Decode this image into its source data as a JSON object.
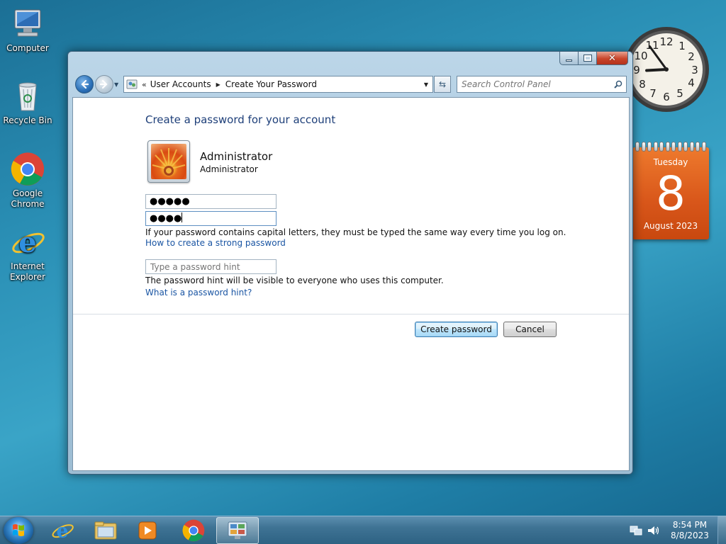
{
  "desktop": {
    "icons": [
      {
        "label": "Computer",
        "icon": "computer-icon"
      },
      {
        "label": "Recycle Bin",
        "icon": "recycle-bin-icon"
      },
      {
        "label": "Google Chrome",
        "icon": "chrome-icon"
      },
      {
        "label": "Internet Explorer",
        "icon": "internet-explorer-icon"
      }
    ]
  },
  "window": {
    "breadcrumb": [
      "User Accounts",
      "Create Your Password"
    ],
    "history_chevron": "«",
    "search_placeholder": "Search Control Panel",
    "heading": "Create a password for your account",
    "user_name": "Administrator",
    "user_role": "Administrator",
    "password_mask": "●●●●●",
    "confirm_mask": "●●●●",
    "caps_note": "If your password contains capital letters, they must be typed the same way every time you log on.",
    "strong_link": "How to create a strong password",
    "hint_placeholder": "Type a password hint",
    "hint_note": "The password hint will be visible to everyone who uses this computer.",
    "hint_link": "What is a password hint?",
    "create_button": "Create password",
    "cancel_button": "Cancel"
  },
  "gadgets": {
    "clock": {
      "hour": 8,
      "minute": 54
    },
    "calendar": {
      "day_name": "Tuesday",
      "day_number": "8",
      "month_year": "August 2023"
    }
  },
  "taskbar": {
    "pinned": [
      "internet-explorer-icon",
      "file-explorer-icon",
      "media-player-icon",
      "chrome-icon",
      "control-panel-icon"
    ],
    "active": "control-panel-icon",
    "time": "8:54 PM",
    "date": "8/8/2023"
  },
  "colors": {
    "heading": "#1e3f79",
    "link": "#1a55a3",
    "calendar": "#d8561a"
  }
}
